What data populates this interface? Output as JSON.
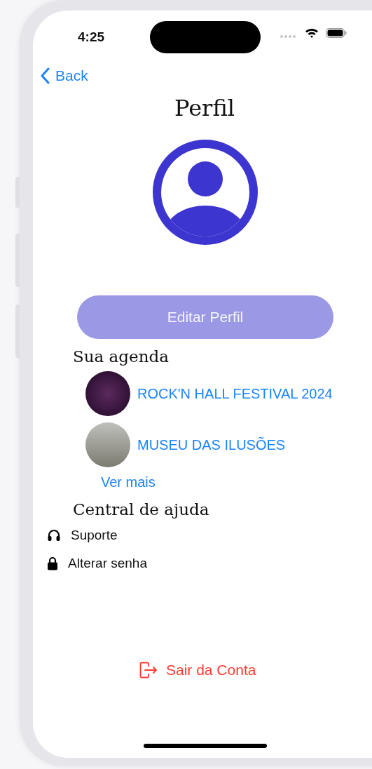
{
  "status_bar": {
    "time": "4:25"
  },
  "navigation": {
    "back": "Back"
  },
  "title": "Perfil",
  "edit_button": "Editar Perfil",
  "agenda": {
    "title": "Sua agenda",
    "events": [
      {
        "name": "ROCK'N HALL FESTIVAL 2024",
        "kind": "rock"
      },
      {
        "name": "MUSEU DAS ILUSÕES",
        "kind": "museum"
      }
    ],
    "see_more": "Ver mais"
  },
  "help": {
    "title": "Central de ajuda",
    "items": [
      {
        "kind": "support",
        "label": "Suporte"
      },
      {
        "kind": "password",
        "label": "Alterar senha"
      }
    ]
  },
  "logout": "Sair da Conta"
}
